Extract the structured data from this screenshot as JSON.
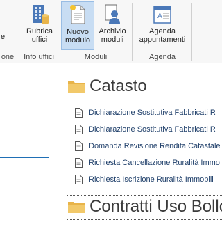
{
  "ribbon": {
    "partial_button_label": "e",
    "partial_group_label": "one",
    "info_group": {
      "label": "Info uffici",
      "rubrica_label_1": "Rubrica",
      "rubrica_label_2": "uffici"
    },
    "moduli_group": {
      "label": "Moduli",
      "nuovo_label_1": "Nuovo",
      "nuovo_label_2": "modulo",
      "archivio_label_1": "Archivio",
      "archivio_label_2": "moduli"
    },
    "agenda_group": {
      "label": "Agenda",
      "agenda_label_1": "Agenda",
      "agenda_label_2": "appuntamenti"
    }
  },
  "sections": [
    {
      "title": "Catasto",
      "items": [
        "Dichiarazione Sostitutiva Fabbricati R",
        "Dichiarazione Sostitutiva Fabbricati R",
        "Domanda Revisione Rendita Catastale",
        "Richiesta Cancellazione Ruralità Immo",
        "Richiesta Iscrizione Ruralità Immobili"
      ]
    },
    {
      "title": "Contratti Uso Bollo",
      "items": []
    }
  ],
  "colors": {
    "accent": "#3b7fc4",
    "active_button": "#c8ddf3",
    "link_text": "#1f3f6a",
    "folder": "#e8b44a"
  }
}
